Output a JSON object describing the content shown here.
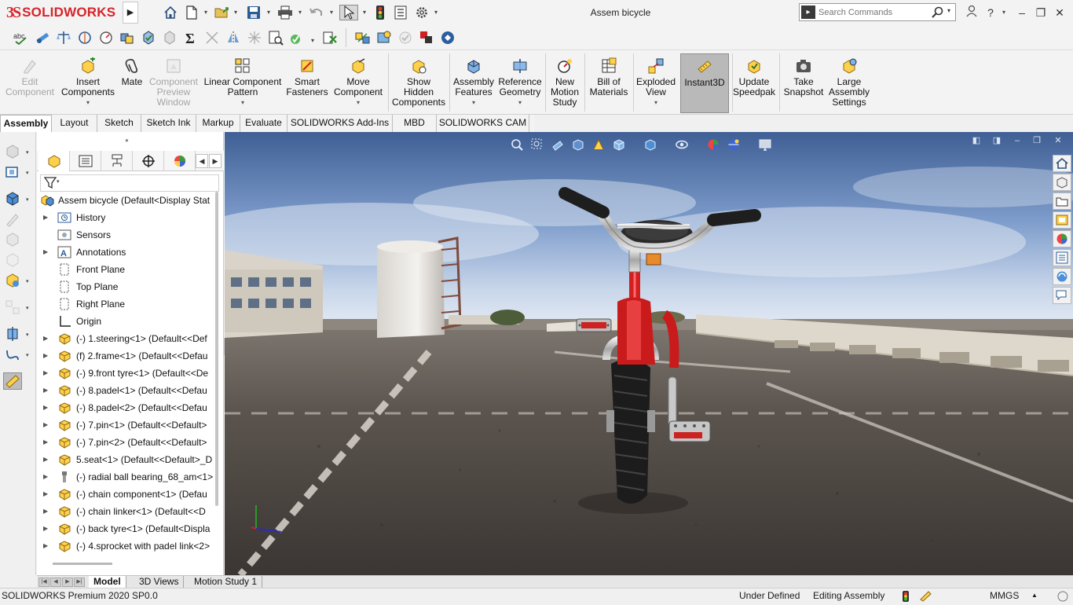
{
  "app": {
    "brand": "SOLIDWORKS",
    "document_title": "Assem bicycle",
    "brand_color": "#d8232a"
  },
  "title_bar": {
    "quick_access": [
      "home-icon",
      "new-document-icon",
      "open-icon",
      "save-icon",
      "print-icon",
      "undo-icon",
      "select-icon",
      "rebuild-icon",
      "file-properties-icon",
      "options-icon"
    ],
    "search": {
      "placeholder": "Search Commands"
    },
    "help_label": "?",
    "window_buttons": [
      "minimize",
      "restore",
      "close"
    ]
  },
  "view_toolbar": {
    "tools": [
      "spell-check-icon",
      "measure-icon",
      "mass-properties-icon",
      "section-properties-icon",
      "check-icon",
      "interference-detection-icon",
      "clearance-verification-icon",
      "equations-icon",
      "hole-alignment-icon",
      "symmetry-check-icon",
      "compare-documents-icon",
      "dimxpert-icon",
      "check-active-document-icon",
      "design-checker-icon",
      "assembly-visualization-icon",
      "performance-evaluation-icon",
      "motion-study-icon",
      "sustainability-icon",
      "toolbox-icon"
    ]
  },
  "command_manager": {
    "commands": [
      {
        "id": "edit-component",
        "label": "Edit\nComponent",
        "enabled": false,
        "has_menu": false
      },
      {
        "id": "insert-components",
        "label": "Insert\nComponents",
        "enabled": true,
        "has_menu": true
      },
      {
        "id": "mate",
        "label": "Mate",
        "enabled": true,
        "has_menu": false
      },
      {
        "id": "component-preview-window",
        "label": "Component\nPreview\nWindow",
        "enabled": false,
        "has_menu": false
      },
      {
        "id": "linear-component-pattern",
        "label": "Linear Component\nPattern",
        "enabled": true,
        "has_menu": true
      },
      {
        "id": "smart-fasteners",
        "label": "Smart\nFasteners",
        "enabled": true,
        "has_menu": false
      },
      {
        "id": "move-component",
        "label": "Move\nComponent",
        "enabled": true,
        "has_menu": true
      },
      {
        "id": "show-hidden-components",
        "label": "Show\nHidden\nComponents",
        "enabled": true,
        "has_menu": false
      },
      {
        "id": "assembly-features",
        "label": "Assembly\nFeatures",
        "enabled": true,
        "has_menu": true
      },
      {
        "id": "reference-geometry",
        "label": "Reference\nGeometry",
        "enabled": true,
        "has_menu": true
      },
      {
        "id": "new-motion-study",
        "label": "New\nMotion\nStudy",
        "enabled": true,
        "has_menu": false
      },
      {
        "id": "bill-of-materials",
        "label": "Bill of\nMaterials",
        "enabled": true,
        "has_menu": false
      },
      {
        "id": "exploded-view",
        "label": "Exploded\nView",
        "enabled": true,
        "has_menu": true
      },
      {
        "id": "instant3d",
        "label": "Instant3D",
        "enabled": true,
        "has_menu": false,
        "active": true
      },
      {
        "id": "update-speedpak",
        "label": "Update\nSpeedpak",
        "enabled": true,
        "has_menu": false
      },
      {
        "id": "take-snapshot",
        "label": "Take\nSnapshot",
        "enabled": true,
        "has_menu": false
      },
      {
        "id": "large-assembly-settings",
        "label": "Large\nAssembly\nSettings",
        "enabled": true,
        "has_menu": false
      }
    ]
  },
  "command_tabs": {
    "active": "Assembly",
    "tabs": [
      "Assembly",
      "Layout",
      "Sketch",
      "Sketch Ink",
      "Markup",
      "Evaluate",
      "SOLIDWORKS Add-Ins",
      "MBD",
      "SOLIDWORKS CAM"
    ]
  },
  "feature_manager": {
    "tabs": [
      "featuremanager-tree-icon",
      "propertymanager-icon",
      "configurationmanager-icon",
      "dimxpertmanager-icon",
      "displaymanager-icon"
    ],
    "root": {
      "label": "Assem bicycle  (Default<Display Stat"
    },
    "items": [
      {
        "label": "History",
        "icon": "history-icon",
        "expandable": true
      },
      {
        "label": "Sensors",
        "icon": "sensors-icon",
        "expandable": false
      },
      {
        "label": "Annotations",
        "icon": "annotations-icon",
        "expandable": true
      },
      {
        "label": "Front Plane",
        "icon": "plane-icon",
        "expandable": false
      },
      {
        "label": "Top Plane",
        "icon": "plane-icon",
        "expandable": false
      },
      {
        "label": "Right Plane",
        "icon": "plane-icon",
        "expandable": false
      },
      {
        "label": "Origin",
        "icon": "origin-icon",
        "expandable": false
      },
      {
        "label": "(-) 1.steering<1>  (Default<<Def",
        "icon": "part-icon",
        "expandable": true
      },
      {
        "label": "(f) 2.frame<1>  (Default<<Defau",
        "icon": "part-icon",
        "expandable": true
      },
      {
        "label": "(-) 9.front tyre<1>  (Default<<De",
        "icon": "part-icon",
        "expandable": true
      },
      {
        "label": "(-) 8.padel<1>  (Default<<Defau",
        "icon": "part-icon",
        "expandable": true
      },
      {
        "label": "(-) 8.padel<2>  (Default<<Defau",
        "icon": "part-icon",
        "expandable": true
      },
      {
        "label": "(-) 7.pin<1>  (Default<<Default>",
        "icon": "part-icon",
        "expandable": true
      },
      {
        "label": "(-) 7.pin<2>  (Default<<Default>",
        "icon": "part-icon",
        "expandable": true
      },
      {
        "label": "5.seat<1>  (Default<<Default>_D",
        "icon": "part-icon",
        "expandable": true
      },
      {
        "label": "(-) radial ball bearing_68_am<1>",
        "icon": "toolbox-part-icon",
        "expandable": true
      },
      {
        "label": "(-) chain component<1>  (Defau",
        "icon": "part-icon",
        "expandable": true
      },
      {
        "label": "(-) chain linker<1>  (Default<<D",
        "icon": "part-icon",
        "expandable": true
      },
      {
        "label": "(-) back tyre<1>  (Default<Displa",
        "icon": "part-icon",
        "expandable": true
      },
      {
        "label": "(-) 4.sprocket with padel link<2>",
        "icon": "part-icon",
        "expandable": true
      }
    ]
  },
  "viewport": {
    "heads_up_tools": [
      "zoom-to-fit-icon",
      "zoom-to-area-icon",
      "previous-view-icon",
      "section-view-icon",
      "dynamic-annotation-icon",
      "view-orientation-icon",
      "display-style-icon",
      "hide-show-items-icon",
      "edit-appearance-icon",
      "apply-scene-icon",
      "view-settings-icon"
    ],
    "task_pane": [
      "solidworks-resources-icon",
      "design-library-icon",
      "file-explorer-icon",
      "view-palette-icon",
      "appearances-icon",
      "custom-properties-icon",
      "solidworks-forum-icon",
      "solidworks-answers-icon"
    ]
  },
  "bottom_tabs": {
    "active": "Model",
    "tabs": [
      "Model",
      "3D Views",
      "Motion Study 1"
    ]
  },
  "status_bar": {
    "product": "SOLIDWORKS Premium 2020 SP0.0",
    "constraint_state": "Under Defined",
    "mode": "Editing Assembly",
    "units": "MMGS"
  }
}
